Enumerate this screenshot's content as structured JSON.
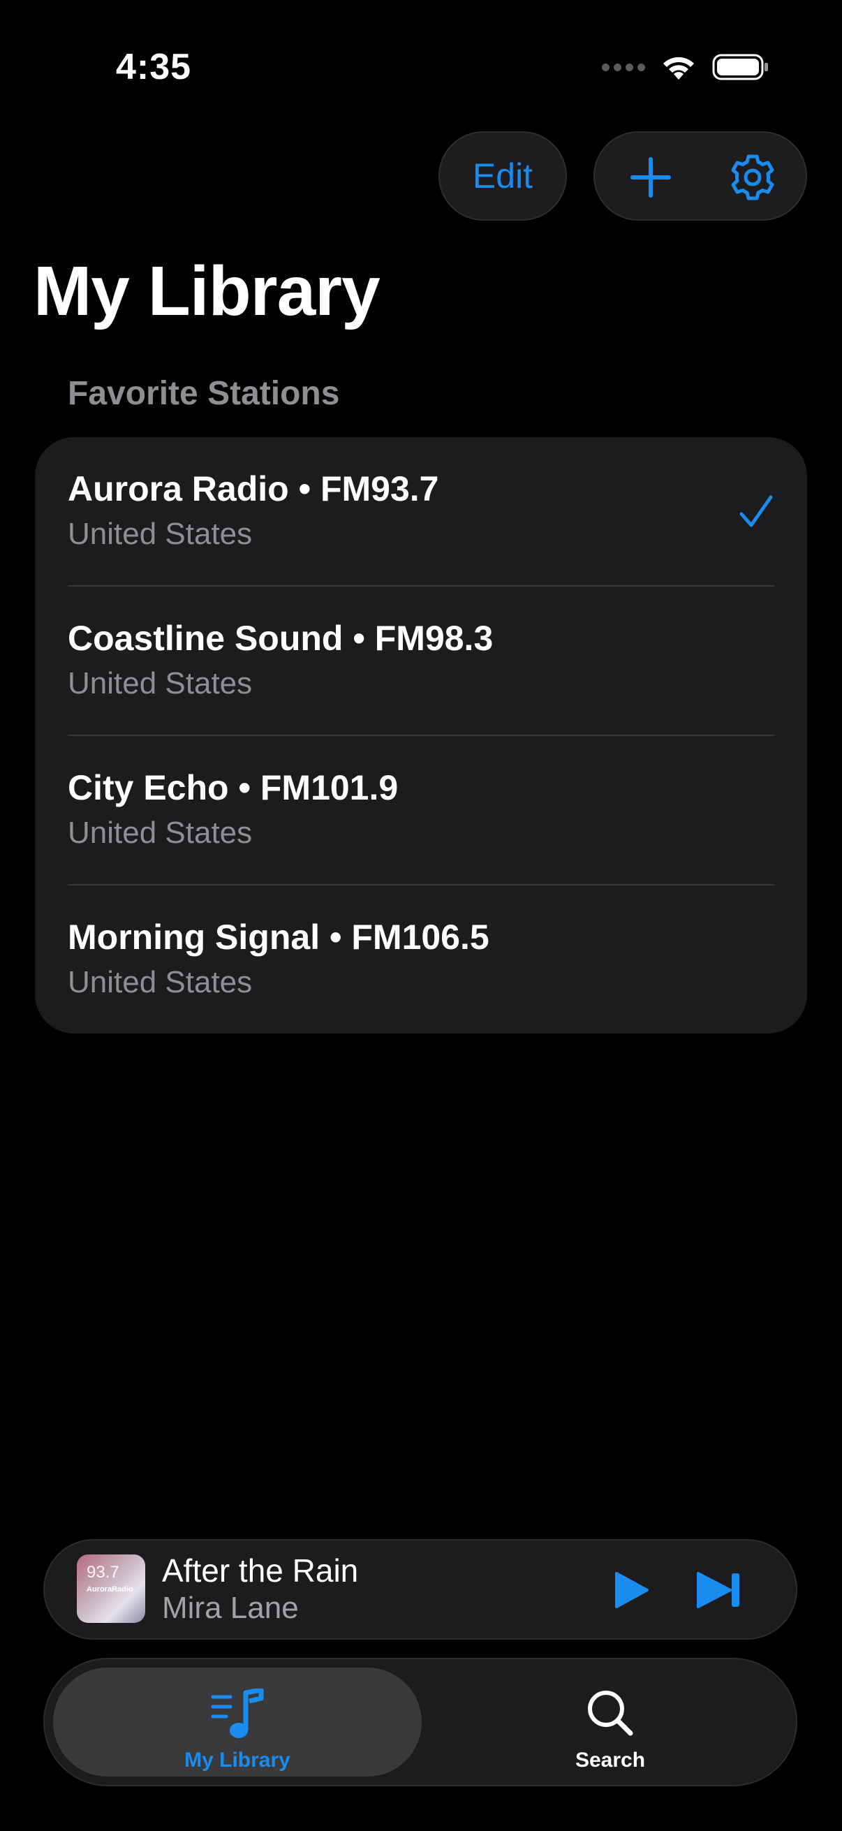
{
  "status_bar": {
    "time": "4:35"
  },
  "toolbar": {
    "edit_label": "Edit",
    "add_icon": "plus-icon",
    "settings_icon": "gear-icon"
  },
  "page": {
    "title": "My Library",
    "section_header": "Favorite Stations"
  },
  "stations": [
    {
      "name": "Aurora Radio • FM93.7",
      "country": "United States",
      "selected": true
    },
    {
      "name": "Coastline Sound • FM98.3",
      "country": "United States",
      "selected": false
    },
    {
      "name": "City Echo • FM101.9",
      "country": "United States",
      "selected": false
    },
    {
      "name": "Morning Signal • FM106.5",
      "country": "United States",
      "selected": false
    }
  ],
  "player": {
    "track_title": "After the Rain",
    "artist": "Mira Lane",
    "artwork_frequency": "93.7",
    "artwork_name": "AuroraRadio"
  },
  "tabs": [
    {
      "label": "My Library",
      "icon": "music-list-icon",
      "active": true
    },
    {
      "label": "Search",
      "icon": "search-icon",
      "active": false
    }
  ],
  "colors": {
    "accent": "#1a8cf0",
    "background": "#000000",
    "card": "#1c1c1e",
    "secondary_text": "#8e8e93"
  }
}
